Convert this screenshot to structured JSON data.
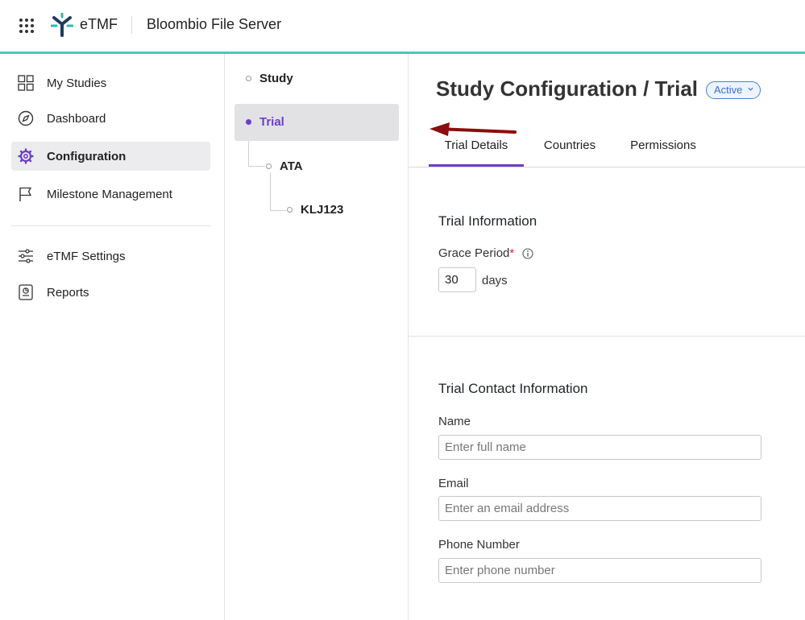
{
  "header": {
    "brand": "eTMF",
    "app_title": "Bloombio File Server",
    "accent_color": "#4fc3bf"
  },
  "sidebar": {
    "items": [
      {
        "label": "My Studies",
        "icon": "grid-icon"
      },
      {
        "label": "Dashboard",
        "icon": "compass-icon"
      },
      {
        "label": "Configuration",
        "icon": "gear-icon",
        "active": true
      },
      {
        "label": "Milestone Management",
        "icon": "flag-icon"
      },
      {
        "label": "eTMF Settings",
        "icon": "sliders-icon"
      },
      {
        "label": "Reports",
        "icon": "report-icon"
      }
    ]
  },
  "tree": {
    "items": [
      {
        "label": "Study"
      },
      {
        "label": "Trial",
        "selected": true
      },
      {
        "label": "ATA"
      },
      {
        "label": "KLJ123"
      }
    ]
  },
  "main": {
    "title": "Study Configuration / Trial",
    "status": "Active",
    "tabs": [
      {
        "label": "Trial Details",
        "active": true
      },
      {
        "label": "Countries"
      },
      {
        "label": "Permissions"
      }
    ],
    "trial_info": {
      "title": "Trial Information",
      "grace_label": "Grace Period",
      "required_mark": "*",
      "grace_value": "30",
      "grace_unit": "days"
    },
    "contact": {
      "title": "Trial Contact Information",
      "name_label": "Name",
      "name_placeholder": "Enter full name",
      "email_label": "Email",
      "email_placeholder": "Enter an email address",
      "phone_label": "Phone Number",
      "phone_placeholder": "Enter phone number"
    }
  },
  "colors": {
    "primary": "#6b3fc8",
    "annotation_arrow": "#8b0d0d",
    "badge_blue": "#3b6fc7"
  }
}
